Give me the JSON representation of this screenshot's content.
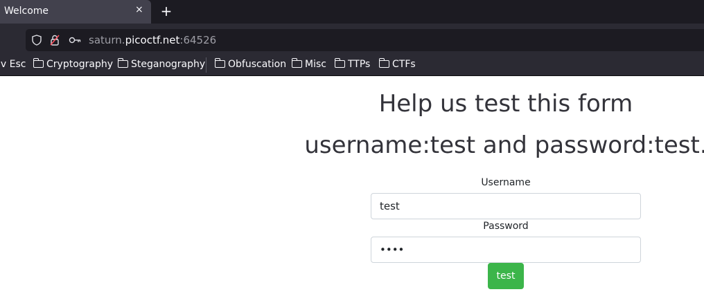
{
  "browser": {
    "tab": {
      "title": "Welcome",
      "close_icon": "×"
    },
    "new_tab_icon": "+",
    "address": {
      "scheme_prefix": "saturn.",
      "host": "picoctf.net",
      "port": ":64526"
    },
    "icons": {
      "shield": "shield-icon",
      "insecure_lock": "insecure-lock-icon",
      "key": "key-icon"
    },
    "bookmarks": [
      {
        "label": "iv Esc",
        "folder": false
      },
      {
        "label": "Cryptography",
        "folder": true
      },
      {
        "label": "Steganography",
        "folder": true
      },
      {
        "label": "Obfuscation",
        "folder": true
      },
      {
        "label": "Misc",
        "folder": true
      },
      {
        "label": "TTPs",
        "folder": true
      },
      {
        "label": "CTFs",
        "folder": true
      }
    ]
  },
  "page": {
    "heading": "Help us test this form",
    "subheading": "username:test and password:test.",
    "form": {
      "username_label": "Username",
      "username_value": "test",
      "password_label": "Password",
      "password_value": "test",
      "submit_label": "test",
      "submit_color": "#3cb54a"
    }
  }
}
